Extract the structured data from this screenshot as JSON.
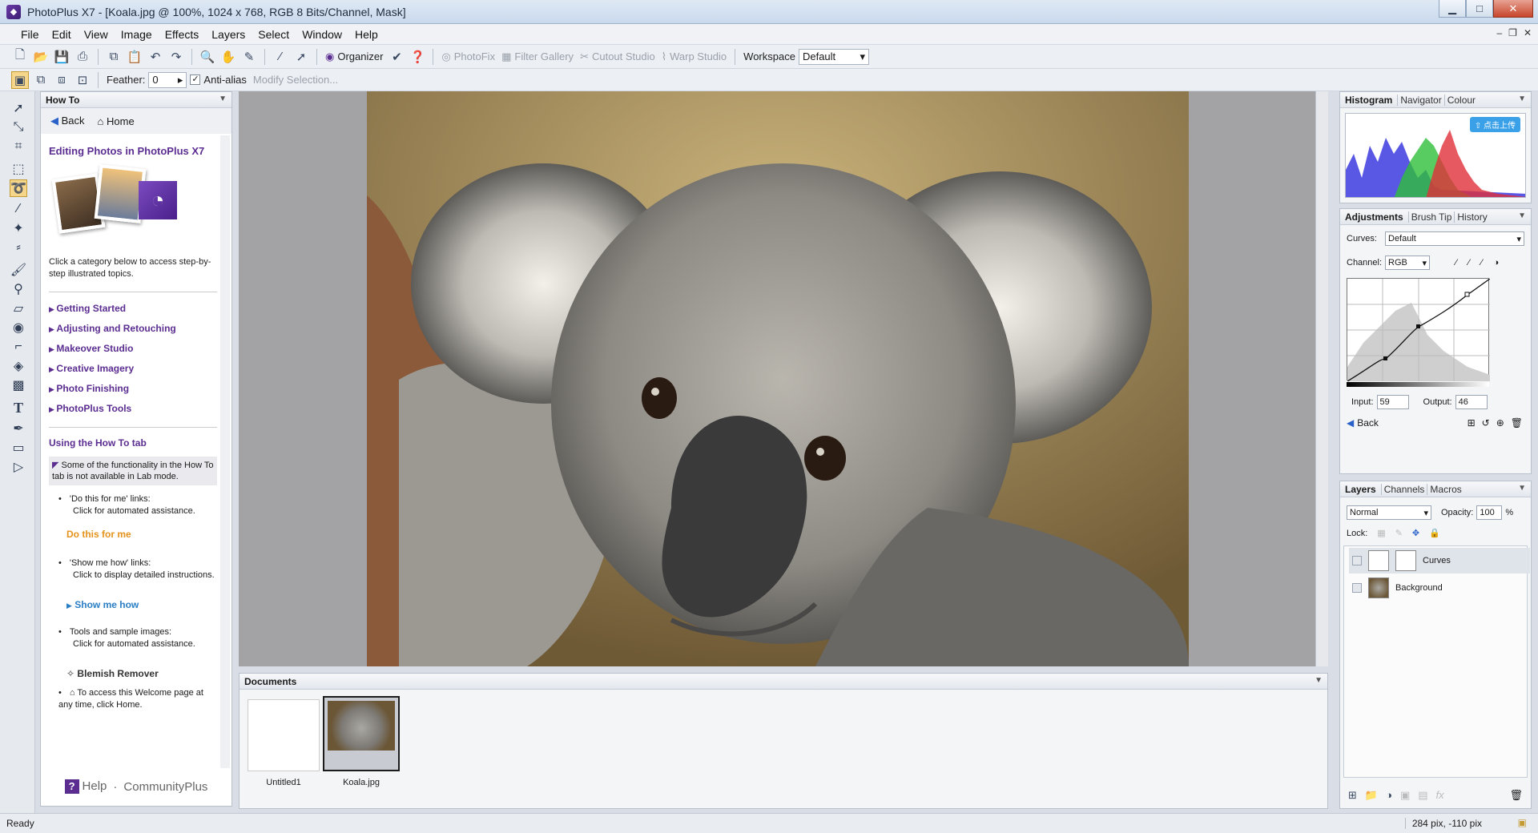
{
  "window": {
    "title": "PhotoPlus X7 - [Koala.jpg @ 100%, 1024 x 768, RGB 8 Bits/Channel, Mask]"
  },
  "menu": [
    "File",
    "Edit",
    "View",
    "Image",
    "Effects",
    "Layers",
    "Select",
    "Window",
    "Help"
  ],
  "toolbar": {
    "organizer": "Organizer",
    "photofix": "PhotoFix",
    "filter_gallery": "Filter Gallery",
    "cutout_studio": "Cutout Studio",
    "warp_studio": "Warp Studio",
    "workspace_label": "Workspace",
    "workspace_value": "Default"
  },
  "context_bar": {
    "feather_label": "Feather:",
    "feather_value": "0",
    "antialias_label": "Anti-alias",
    "antialias_checked": true,
    "modify_selection": "Modify Selection..."
  },
  "howto": {
    "tab": "How To",
    "back": "Back",
    "home": "Home",
    "heading": "Editing Photos in PhotoPlus X7",
    "intro": "Click a category below to access step-by-step illustrated topics.",
    "categories": [
      "Getting Started",
      "Adjusting and Retouching",
      "Makeover Studio",
      "Creative Imagery",
      "Photo Finishing",
      "PhotoPlus Tools"
    ],
    "using_heading": "Using the How To tab",
    "note": "Some of the functionality in the How To tab is not available in Lab mode.",
    "bullet1_title": "'Do this for me' links:",
    "bullet1_text": "Click for automated assistance.",
    "do_link": "Do this for me",
    "bullet2_title": "'Show me how' links:",
    "bullet2_text": "Click to display detailed instructions.",
    "show_link": "Show me how",
    "bullet3_title": "Tools and sample images:",
    "bullet3_text": "Click for automated assistance.",
    "blemish": "Blemish Remover",
    "home_text": "To access this Welcome page at any time, click Home.",
    "footer_help": "Help",
    "footer_community": "CommunityPlus"
  },
  "documents": {
    "title": "Documents",
    "items": [
      {
        "name": "Untitled1"
      },
      {
        "name": "Koala.jpg"
      }
    ]
  },
  "histogram": {
    "tabs": [
      "Histogram",
      "Navigator",
      "Colour"
    ],
    "badge": "点击上传"
  },
  "adjustments": {
    "tabs": [
      "Adjustments",
      "Brush Tip",
      "History"
    ],
    "curves_label": "Curves:",
    "curves_value": "Default",
    "channel_label": "Channel:",
    "channel_value": "RGB",
    "input_label": "Input:",
    "input_value": "59",
    "output_label": "Output:",
    "output_value": "46",
    "back": "Back"
  },
  "layers": {
    "tabs": [
      "Layers",
      "Channels",
      "Macros"
    ],
    "blend_mode": "Normal",
    "opacity_label": "Opacity:",
    "opacity_value": "100",
    "opacity_unit": "%",
    "lock_label": "Lock:",
    "items": [
      {
        "name": "Curves"
      },
      {
        "name": "Background"
      }
    ]
  },
  "status": {
    "left": "Ready",
    "right": "284 pix, -110 pix"
  },
  "colors": {
    "accent": "#5b2d91",
    "orange_link": "#e5931c",
    "blue_link": "#2a7ec5"
  }
}
